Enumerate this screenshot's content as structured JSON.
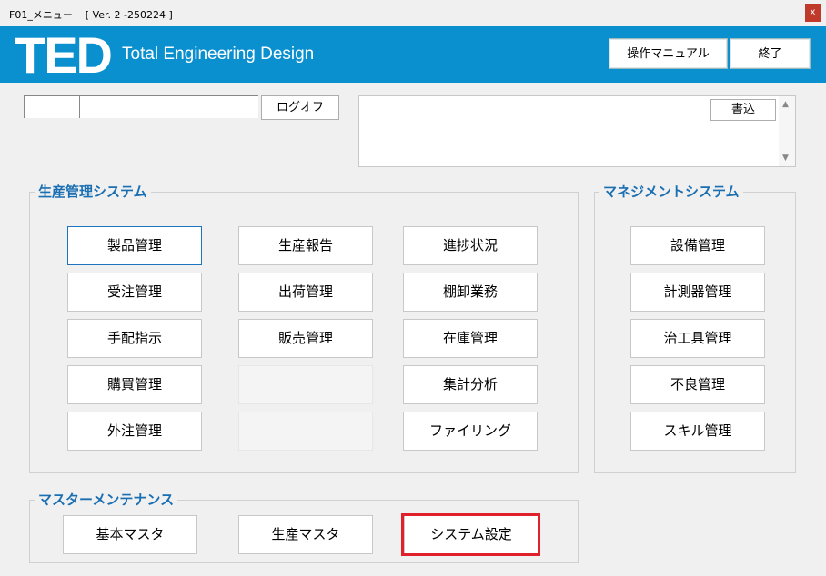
{
  "window": {
    "title": "F01_メニュー    [ Ver. 2 -250224 ]",
    "close": "x"
  },
  "header": {
    "logo": "TED",
    "subtitle": "Total Engineering Design",
    "manual_label": "操作マニュアル",
    "exit_label": "終了"
  },
  "login": {
    "field1_value": "",
    "field2_value": "",
    "logoff_label": "ログオフ"
  },
  "memo": {
    "value": "",
    "write_label": "書込"
  },
  "groups": {
    "production": {
      "title": "生産管理システム",
      "col1": [
        "製品管理",
        "受注管理",
        "手配指示",
        "購買管理",
        "外注管理"
      ],
      "col2": [
        "生産報告",
        "出荷管理",
        "販売管理",
        "",
        ""
      ],
      "col3": [
        "進捗状況",
        "棚卸業務",
        "在庫管理",
        "集計分析",
        "ファイリング"
      ]
    },
    "management": {
      "title": "マネジメントシステム",
      "items": [
        "設備管理",
        "計測器管理",
        "治工具管理",
        "不良管理",
        "スキル管理"
      ]
    },
    "master": {
      "title": "マスターメンテナンス",
      "items": [
        "基本マスタ",
        "生産マスタ",
        "システム設定"
      ]
    }
  },
  "colors": {
    "banner": "#0a8fcf",
    "group_title": "#1a6fb3",
    "highlight": "#e0202a"
  }
}
